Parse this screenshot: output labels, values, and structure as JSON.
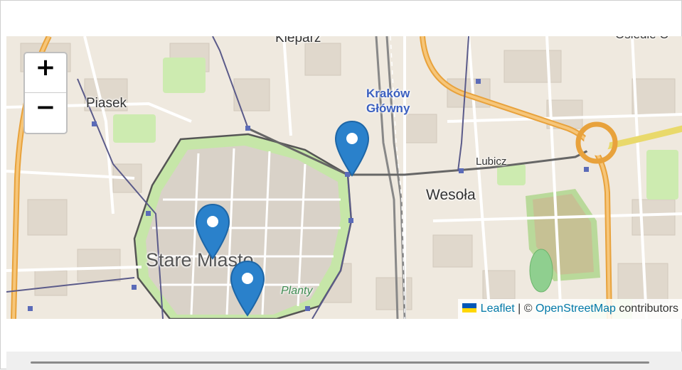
{
  "map": {
    "zoom_in_label": "+",
    "zoom_out_label": "−",
    "labels": {
      "kleparz": "Kleparz",
      "osiedle": "Osiedle O",
      "piasek": "Piasek",
      "station_line1": "Kraków",
      "station_line2": "Główny",
      "lubicz": "Lubicz",
      "wesola": "Wesoła",
      "stare_miasto": "Stare Miasto",
      "planty": "Planty"
    },
    "markers": [
      "marker-1",
      "marker-2",
      "marker-3"
    ],
    "marker_color": "#2a81cb",
    "attribution": {
      "leaflet": "Leaflet",
      "separator": " | © ",
      "osm": "OpenStreetMap",
      "suffix": " contributors"
    }
  }
}
